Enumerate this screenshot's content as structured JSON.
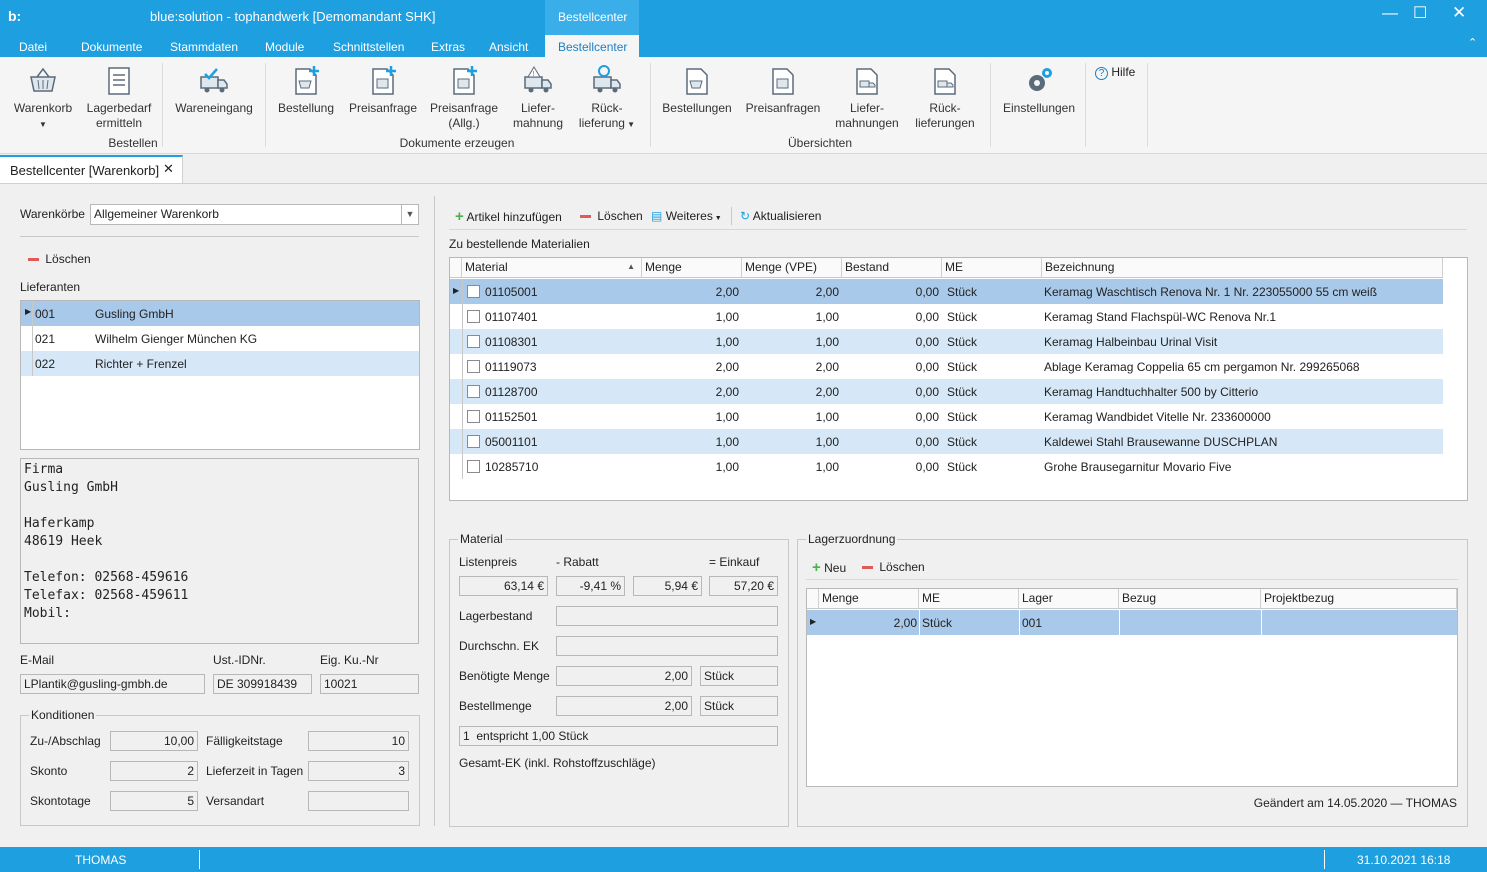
{
  "app": {
    "logo": "b:",
    "title": "blue:solution - tophandwerk [Demomandant SHK]",
    "context_tab": "Bestellcenter"
  },
  "menu": [
    "Datei",
    "Dokumente",
    "Stammdaten",
    "Module",
    "Schnittstellen",
    "Extras",
    "Ansicht",
    "Bestellcenter"
  ],
  "ribbon": {
    "warenkorb": "Warenkorb",
    "lagerbedarf": "Lagerbedarf",
    "lagerbedarf2": "ermitteln",
    "wareneingang": "Wareneingang",
    "group_bestellen": "Bestellen",
    "bestellung": "Bestellung",
    "preisanfrage": "Preisanfrage",
    "preisanfrage_allg": "Preisanfrage",
    "preisanfrage_allg2": "(Allg.)",
    "liefermahnung": "Liefer-",
    "liefermahnung2": "mahnung",
    "ruecklieferung": "Rück-",
    "ruecklieferung2": "lieferung",
    "group_dokumente": "Dokumente erzeugen",
    "bestellungen": "Bestellungen",
    "preisanfragen": "Preisanfragen",
    "liefermahnungen": "Liefer-",
    "liefermahnungen2": "mahnungen",
    "ruecklieferungen": "Rück-",
    "ruecklieferungen2": "lieferungen",
    "group_uebersichten": "Übersichten",
    "einstellungen": "Einstellungen",
    "hilfe": "Hilfe"
  },
  "doc_tab": "Bestellcenter [Warenkorb]",
  "left": {
    "warenkoerbe_label": "Warenkörbe",
    "warenkorb_value": "Allgemeiner Warenkorb",
    "loeschen": "Löschen",
    "lieferanten_label": "Lieferanten",
    "lieferanten": [
      {
        "nr": "001",
        "name": "Gusling GmbH"
      },
      {
        "nr": "021",
        "name": "Wilhelm Gienger München KG"
      },
      {
        "nr": "022",
        "name": "Richter + Frenzel"
      }
    ],
    "address": [
      "Firma",
      "Gusling GmbH",
      "",
      "Haferkamp",
      "48619 Heek",
      "",
      "Telefon: 02568-459616",
      "Telefax: 02568-459611",
      "Mobil:"
    ],
    "email_label": "E-Mail",
    "email": "LPlantik@gusling-gmbh.de",
    "ust_label": "Ust.-IDNr.",
    "ust": "DE 309918439",
    "kunr_label": "Eig. Ku.-Nr",
    "kunr": "10021",
    "konditionen": "Konditionen",
    "zuab_label": "Zu-/Abschlag",
    "zuab": "10,00",
    "faellig_label": "Fälligkeitstage",
    "faellig": "10",
    "skonto_label": "Skonto",
    "skonto": "2",
    "lieferzeit_label": "Lieferzeit in Tagen",
    "lieferzeit": "3",
    "skontotage_label": "Skontotage",
    "skontotage": "5",
    "versandart_label": "Versandart",
    "versandart": ""
  },
  "toolbar": {
    "add": "Artikel hinzufügen",
    "del": "Löschen",
    "more": "Weiteres",
    "refresh": "Aktualisieren"
  },
  "materials": {
    "title": "Zu bestellende Materialien",
    "headers": [
      "Material",
      "Menge",
      "Menge (VPE)",
      "Bestand",
      "ME",
      "Bezeichnung"
    ],
    "rows": [
      {
        "mat": "01105001",
        "menge": "2,00",
        "vpe": "2,00",
        "bestand": "0,00",
        "me": "Stück",
        "bez": "Keramag Waschtisch Renova Nr. 1 Nr. 223055000 55 cm weiß"
      },
      {
        "mat": "01107401",
        "menge": "1,00",
        "vpe": "1,00",
        "bestand": "0,00",
        "me": "Stück",
        "bez": "Keramag Stand Flachspül-WC Renova Nr.1"
      },
      {
        "mat": "01108301",
        "menge": "1,00",
        "vpe": "1,00",
        "bestand": "0,00",
        "me": "Stück",
        "bez": "Keramag Halbeinbau Urinal Visit"
      },
      {
        "mat": "01119073",
        "menge": "2,00",
        "vpe": "2,00",
        "bestand": "0,00",
        "me": "Stück",
        "bez": "Ablage Keramag Coppelia 65 cm pergamon Nr. 299265068"
      },
      {
        "mat": "01128700",
        "menge": "2,00",
        "vpe": "2,00",
        "bestand": "0,00",
        "me": "Stück",
        "bez": "Keramag Handtuchhalter 500 by Citterio"
      },
      {
        "mat": "01152501",
        "menge": "1,00",
        "vpe": "1,00",
        "bestand": "0,00",
        "me": "Stück",
        "bez": "Keramag Wandbidet Vitelle Nr. 233600000"
      },
      {
        "mat": "05001101",
        "menge": "1,00",
        "vpe": "1,00",
        "bestand": "0,00",
        "me": "Stück",
        "bez": "Kaldewei Stahl Brausewanne DUSCHPLAN"
      },
      {
        "mat": "10285710",
        "menge": "1,00",
        "vpe": "1,00",
        "bestand": "0,00",
        "me": "Stück",
        "bez": "Grohe Brausegarnitur Movario Five"
      }
    ]
  },
  "material": {
    "title": "Material",
    "listenpreis_label": "Listenpreis",
    "rabatt_label": "- Rabatt",
    "einkauf_label": "= Einkauf",
    "listenpreis": "63,14 €",
    "rabatt_pct": "-9,41 %",
    "rabatt": "5,94 €",
    "einkauf": "57,20 €",
    "lagerbestand_label": "Lagerbestand",
    "durchschn_label": "Durchschn. EK",
    "benoetigt_label": "Benötigte Menge",
    "benoetigt": "2,00",
    "benoetigt_me": "Stück",
    "bestellmenge_label": "Bestellmenge",
    "bestellmenge": "2,00",
    "bestellmenge_me": "Stück",
    "entspricht": "1  entspricht 1,00 Stück",
    "gesamt_label": "Gesamt-EK (inkl. Rohstoffzuschläge)"
  },
  "lager": {
    "title": "Lagerzuordnung",
    "neu": "Neu",
    "loeschen": "Löschen",
    "headers": [
      "Menge",
      "ME",
      "Lager",
      "Bezug",
      "Projektbezug"
    ],
    "rows": [
      {
        "menge": "2,00",
        "me": "Stück",
        "lager": "001",
        "bezug": "",
        "projekt": ""
      }
    ],
    "changed": "Geändert am 14.05.2020 — THOMAS"
  },
  "status": {
    "user": "THOMAS",
    "datetime": "31.10.2021 16:18"
  },
  "colors": {
    "accent": "#1e9fe0",
    "selected": "#a9c9ea",
    "alt": "#d6e8f7"
  }
}
